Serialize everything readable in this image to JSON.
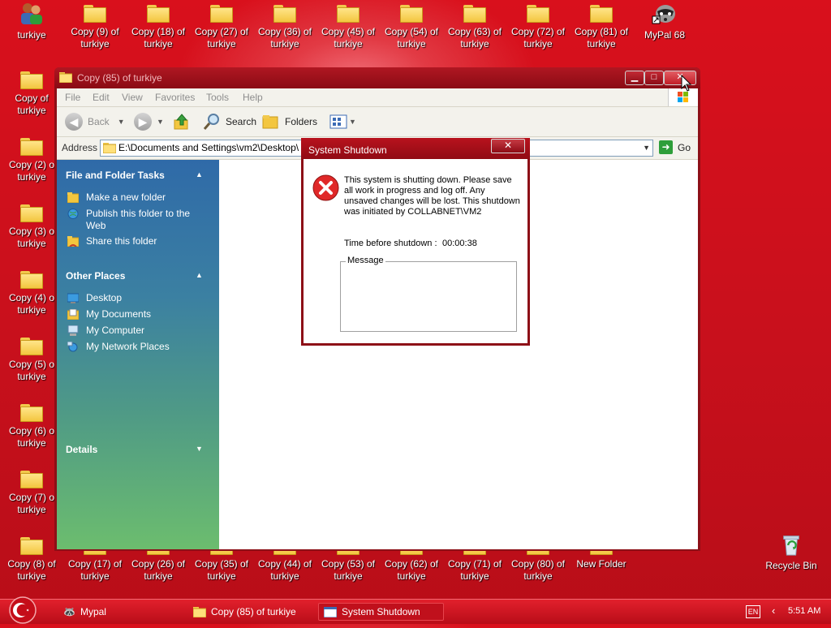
{
  "desktop": {
    "top_row": [
      {
        "label": "turkiye",
        "icon": "people-icon"
      },
      {
        "label": "Copy (9) of\nturkiye",
        "icon": "folder-icon"
      },
      {
        "label": "Copy (18) of\nturkiye",
        "icon": "folder-icon"
      },
      {
        "label": "Copy (27) of\nturkiye",
        "icon": "folder-icon"
      },
      {
        "label": "Copy (36) of\nturkiye",
        "icon": "folder-icon"
      },
      {
        "label": "Copy (45) of\nturkiye",
        "icon": "folder-icon"
      },
      {
        "label": "Copy (54) of\nturkiye",
        "icon": "folder-icon"
      },
      {
        "label": "Copy (63) of\nturkiye",
        "icon": "folder-icon"
      },
      {
        "label": "Copy (72) of\nturkiye",
        "icon": "folder-icon"
      },
      {
        "label": "Copy (81) of\nturkiye",
        "icon": "folder-icon"
      },
      {
        "label": "MyPal 68",
        "icon": "raccoon-shortcut-icon"
      }
    ],
    "left_column": [
      {
        "label": "Copy of\nturkiye"
      },
      {
        "label": "Copy (2) o\nturkiye"
      },
      {
        "label": "Copy (3) o\nturkiye"
      },
      {
        "label": "Copy (4) o\nturkiye"
      },
      {
        "label": "Copy (5) o\nturkiye"
      },
      {
        "label": "Copy (6) o\nturkiye"
      },
      {
        "label": "Copy (7) o\nturkiye"
      }
    ],
    "bottom_row": [
      {
        "label": "Copy (8) of\nturkiye"
      },
      {
        "label": "Copy (17) of\nturkiye"
      },
      {
        "label": "Copy (26) of\nturkiye"
      },
      {
        "label": "Copy (35) of\nturkiye"
      },
      {
        "label": "Copy (44) of\nturkiye"
      },
      {
        "label": "Copy (53) of\nturkiye"
      },
      {
        "label": "Copy (62) of\nturkiye"
      },
      {
        "label": "Copy (71) of\nturkiye"
      },
      {
        "label": "Copy (80) of\nturkiye"
      },
      {
        "label": "New Folder"
      }
    ],
    "recycle_bin": "Recycle Bin"
  },
  "explorer": {
    "title": "Copy (85) of turkiye",
    "menu": [
      "File",
      "Edit",
      "View",
      "Favorites",
      "Tools",
      "Help"
    ],
    "toolbar": {
      "back": "Back",
      "search": "Search",
      "folders": "Folders"
    },
    "address_label": "Address",
    "address_value": "E:\\Documents and Settings\\vm2\\Desktop\\",
    "go_label": "Go",
    "sidebar": {
      "file_tasks_title": "File and Folder Tasks",
      "file_tasks": [
        "Make a new folder",
        "Publish this folder to the\nWeb",
        "Share this folder"
      ],
      "other_places_title": "Other Places",
      "other_places": [
        "Desktop",
        "My Documents",
        "My Computer",
        "My Network Places"
      ],
      "details_title": "Details"
    }
  },
  "dialog": {
    "title": "System Shutdown",
    "close_glyph": "✕",
    "message": "This system is shutting down. Please save all work in progress and log off. Any unsaved changes will be lost. This shutdown was initiated by COLLABNET\\VM2",
    "time_label": "Time before shutdown :",
    "time_value": "00:00:38",
    "message_group": "Message"
  },
  "taskbar": {
    "tasks": [
      "Mypal",
      "Copy (85) of turkiye",
      "System Shutdown"
    ],
    "language": "EN",
    "clock": "5:51 AM"
  }
}
